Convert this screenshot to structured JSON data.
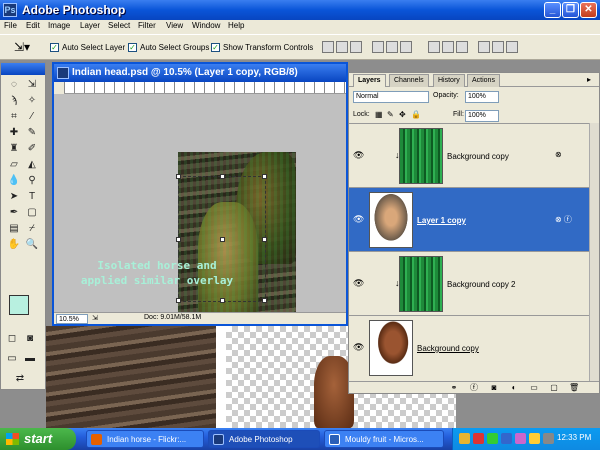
{
  "app": {
    "title": "Adobe Photoshop",
    "icon": "photoshop-icon"
  },
  "menu": [
    "File",
    "Edit",
    "Image",
    "Layer",
    "Select",
    "Filter",
    "View",
    "Window",
    "Help"
  ],
  "options": {
    "auto_select_layer": {
      "label": "Auto Select Layer",
      "checked": true
    },
    "auto_select_groups": {
      "label": "Auto Select Groups",
      "checked": true
    },
    "show_transform_controls": {
      "label": "Show Transform Controls",
      "checked": true
    }
  },
  "document": {
    "title": "Indian head.psd @ 10.5% (Layer 1 copy, RGB/8)",
    "zoom": "10.5%",
    "doc_info": "Doc: 9.01M/58.1M",
    "annotation_line1": "Isolated horse and",
    "annotation_line2": "applied similar overlay"
  },
  "layers_panel": {
    "tabs": [
      "Layers",
      "Channels",
      "History",
      "Actions"
    ],
    "blend_mode": "Normal",
    "opacity_label": "Opacity:",
    "opacity": "100%",
    "lock_label": "Lock:",
    "fill_label": "Fill:",
    "fill": "100%",
    "layers": [
      {
        "name": "Background copy",
        "thumb": "green",
        "selected": false
      },
      {
        "name": "Layer 1 copy",
        "thumb": "portrait",
        "selected": true
      },
      {
        "name": "Background copy 2",
        "thumb": "green",
        "selected": false
      },
      {
        "name": "Background copy",
        "thumb": "horse",
        "selected": false
      }
    ]
  },
  "taskbar": {
    "start": "start",
    "tasks": [
      "Indian horse - Flickr:...",
      "Adobe Photoshop",
      "Mouldy fruit - Micros..."
    ],
    "active_task": 1,
    "clock": "12:33 PM"
  },
  "colors": {
    "accent": "#0a55d8",
    "selection": "#316ac5",
    "foreground_swatch": "#b8f0e0",
    "taskbar": "#245edb",
    "start": "#2d8f2d"
  }
}
